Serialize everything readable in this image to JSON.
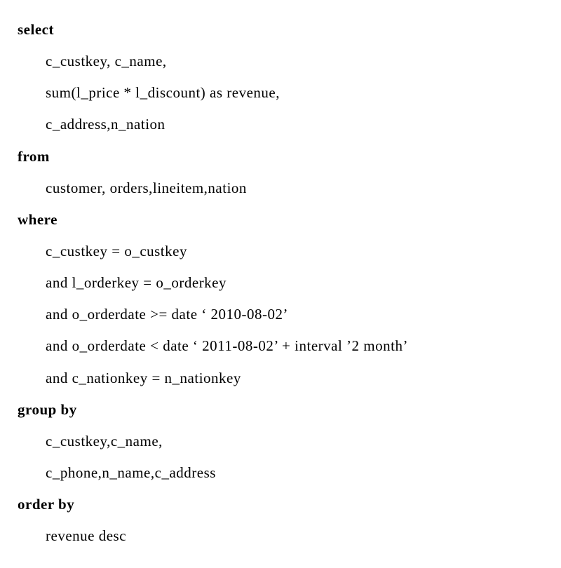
{
  "sql": {
    "select_kw": "select",
    "select_line1": "c_custkey, c_name,",
    "select_line2": "sum(l_price * l_discount) as revenue,",
    "select_line3": "c_address,n_nation",
    "from_kw": "from",
    "from_line1": "customer, orders,lineitem,nation",
    "where_kw": "where",
    "where_line1": "c_custkey = o_custkey",
    "where_line2": "and l_orderkey = o_orderkey",
    "where_line3": "and o_orderdate >= date ‘ 2010-08-02’",
    "where_line4": "and o_orderdate < date ‘ 2011-08-02’ + interval ’2 month’",
    "where_line5": "and c_nationkey = n_nationkey",
    "groupby_kw": "group by",
    "groupby_line1": "c_custkey,c_name,",
    "groupby_line2": "c_phone,n_name,c_address",
    "orderby_kw": "order by",
    "orderby_line1": "revenue desc"
  }
}
